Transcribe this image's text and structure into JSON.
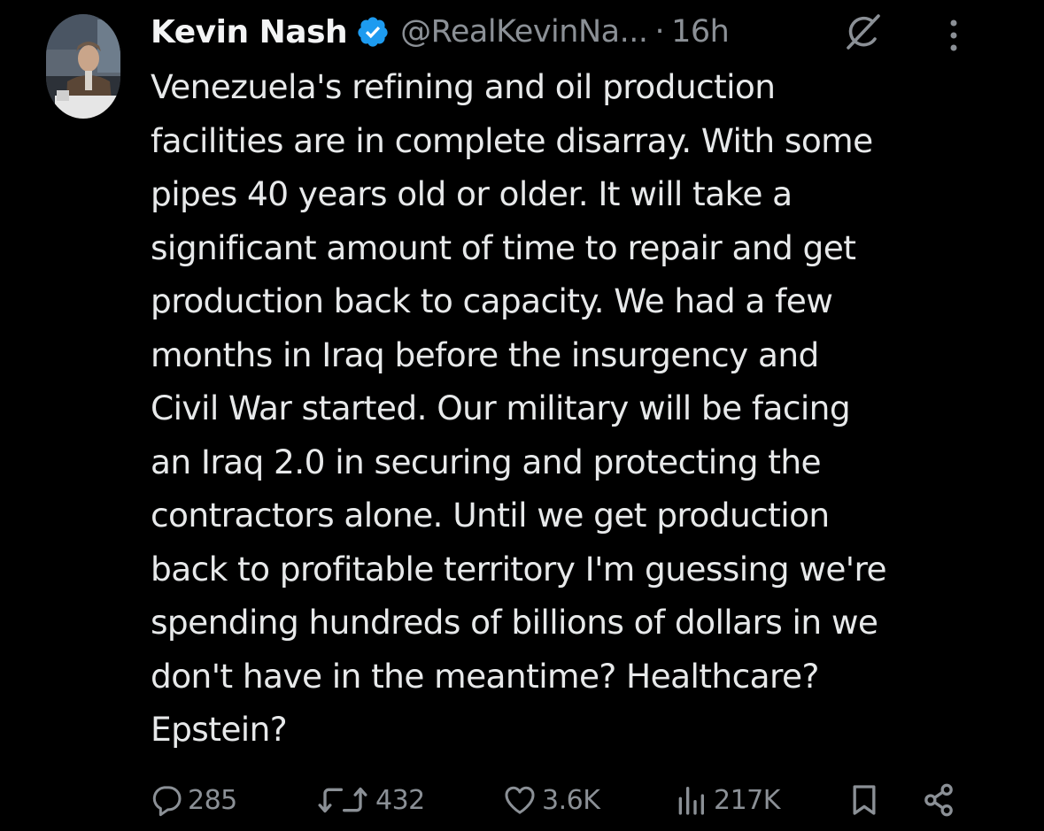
{
  "author": {
    "name": "Kevin Nash",
    "handle": "@RealKevinNa...",
    "separator": "·",
    "time": "16h",
    "verified": true,
    "verified_color": "#1d9bf0"
  },
  "tweet": {
    "text": "Venezuela's refining and oil production\nfacilities are in complete disarray. With some\npipes 40 years old or older. It will take a\nsignificant amount of time to repair and get\nproduction back to capacity. We had a few\nmonths in Iraq before the insurgency and\nCivil War started.  Our military will be facing\nan Iraq 2.0 in securing and protecting the\ncontractors alone. Until we get production\nback to profitable territory I'm guessing we're\nspending hundreds of billions of dollars in we\ndon't have in the meantime? Healthcare?\nEpstein?"
  },
  "actions": {
    "replies": "285",
    "reposts": "432",
    "likes": "3.6K",
    "views": "217K"
  },
  "icons": {
    "avatar": "avatar",
    "verified": "verified-badge-icon",
    "grok": "grok-icon",
    "more": "more-options-icon",
    "reply": "reply-icon",
    "repost": "repost-icon",
    "like": "heart-icon",
    "views": "views-chart-icon",
    "bookmark": "bookmark-icon",
    "share": "share-icon"
  },
  "colors": {
    "background": "#000000",
    "text": "#e7e9ea",
    "muted": "#8b9096"
  }
}
